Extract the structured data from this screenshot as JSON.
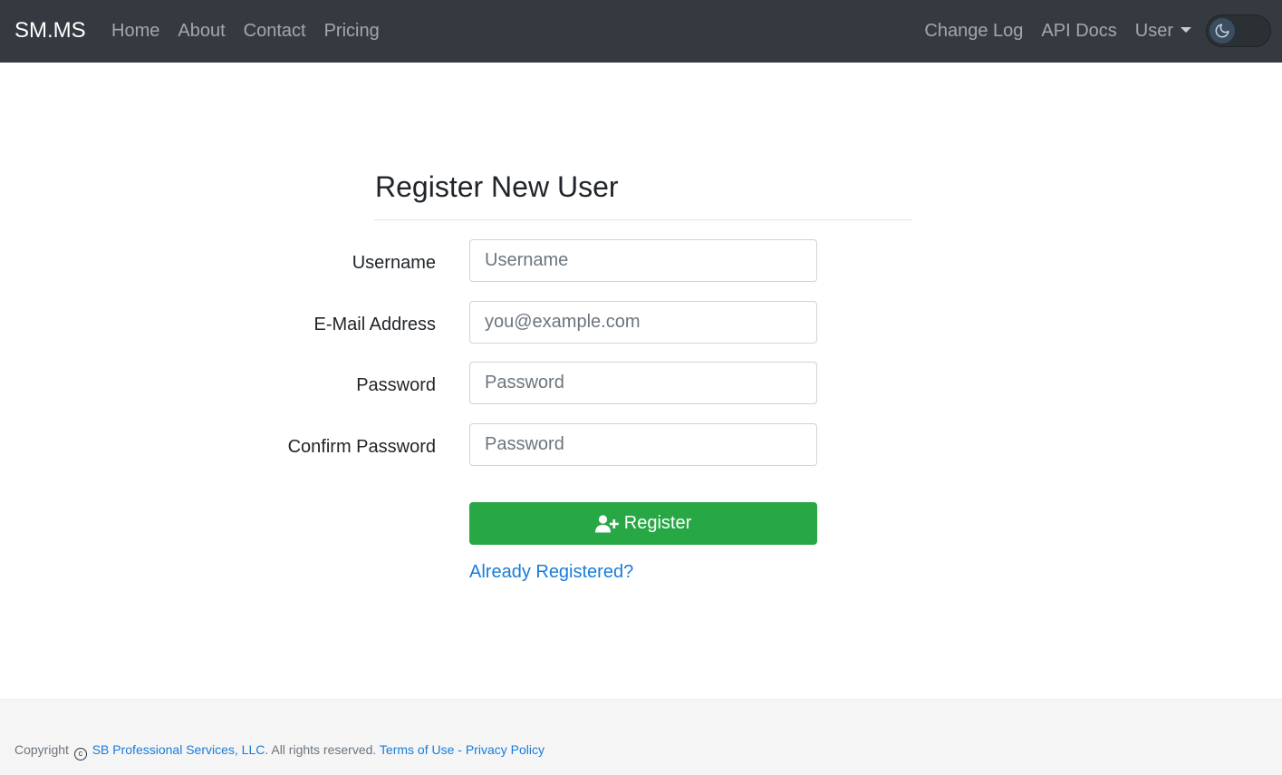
{
  "navbar": {
    "brand": "SM.MS",
    "left_links": [
      "Home",
      "About",
      "Contact",
      "Pricing"
    ],
    "right_links": [
      "Change Log",
      "API Docs"
    ],
    "user_menu": "User",
    "theme_toggle_icon": "moon-icon"
  },
  "form": {
    "title": "Register New User",
    "fields": [
      {
        "label": "Username",
        "placeholder": "Username",
        "value": ""
      },
      {
        "label": "E-Mail Address",
        "placeholder": "you@example.com",
        "value": ""
      },
      {
        "label": "Password",
        "placeholder": "Password",
        "value": ""
      },
      {
        "label": "Confirm Password",
        "placeholder": "Password",
        "value": ""
      }
    ],
    "submit_label": "Register",
    "submit_icon": "user-plus-icon",
    "login_link": "Already Registered?"
  },
  "footer": {
    "copyright_prefix": "Copyright",
    "copyright_symbol": "c",
    "company": "SB Professional Services, LLC",
    "rights": ". All rights reserved.",
    "terms": "Terms of Use",
    "separator": " - ",
    "privacy": "Privacy Policy"
  },
  "colors": {
    "navbar_bg": "#343a40",
    "success": "#28a745",
    "link": "#1a7bd9",
    "footer_bg": "#f5f5f5"
  }
}
